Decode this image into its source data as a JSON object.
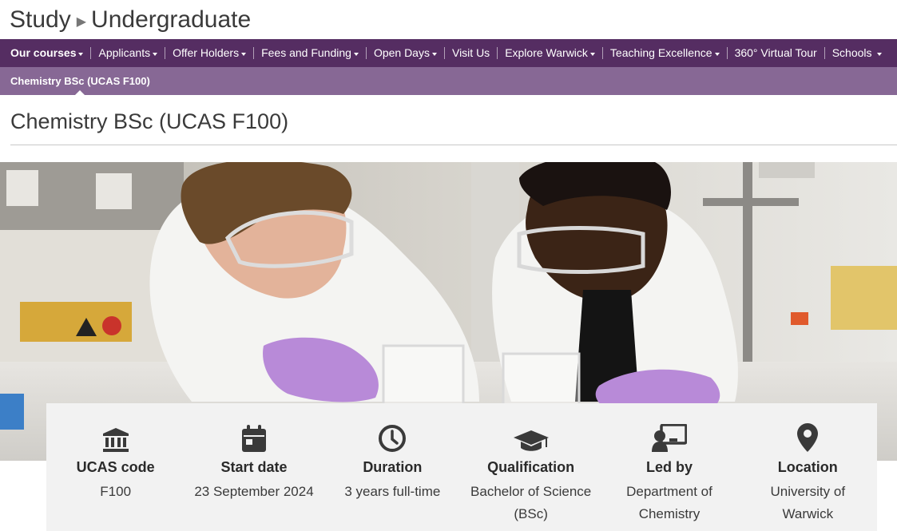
{
  "header": {
    "section": "Study",
    "subsection": "Undergraduate"
  },
  "nav": {
    "items": [
      {
        "label": "Our courses",
        "dropdown": true
      },
      {
        "label": "Applicants",
        "dropdown": true
      },
      {
        "label": "Offer Holders",
        "dropdown": true
      },
      {
        "label": "Fees and Funding",
        "dropdown": true
      },
      {
        "label": "Open Days",
        "dropdown": true
      },
      {
        "label": "Visit Us",
        "dropdown": false
      },
      {
        "label": "Explore Warwick",
        "dropdown": true
      },
      {
        "label": "Teaching Excellence",
        "dropdown": true
      },
      {
        "label": "360° Virtual Tour",
        "dropdown": false
      },
      {
        "label": "Schools",
        "dropdown": true
      }
    ]
  },
  "subnav": {
    "current": "Chemistry BSc (UCAS F100)"
  },
  "page": {
    "title": "Chemistry BSc (UCAS F100)"
  },
  "hero": {
    "icon": "lab-students-photo"
  },
  "info": [
    {
      "icon": "bank-icon",
      "label": "UCAS code",
      "value": "F100"
    },
    {
      "icon": "calendar-icon",
      "label": "Start date",
      "value": "23 September 2024"
    },
    {
      "icon": "clock-icon",
      "label": "Duration",
      "value": "3 years full-time"
    },
    {
      "icon": "graduation-cap-icon",
      "label": "Qualification",
      "value": "Bachelor of Science (BSc)"
    },
    {
      "icon": "presenter-icon",
      "label": "Led by",
      "value": "Department of Chemistry"
    },
    {
      "icon": "location-pin-icon",
      "label": "Location",
      "value": "University of Warwick"
    }
  ],
  "colors": {
    "nav": "#552d62",
    "subnav": "#876895",
    "panel": "#f2f2f2",
    "icon": "#3a3a3a"
  }
}
